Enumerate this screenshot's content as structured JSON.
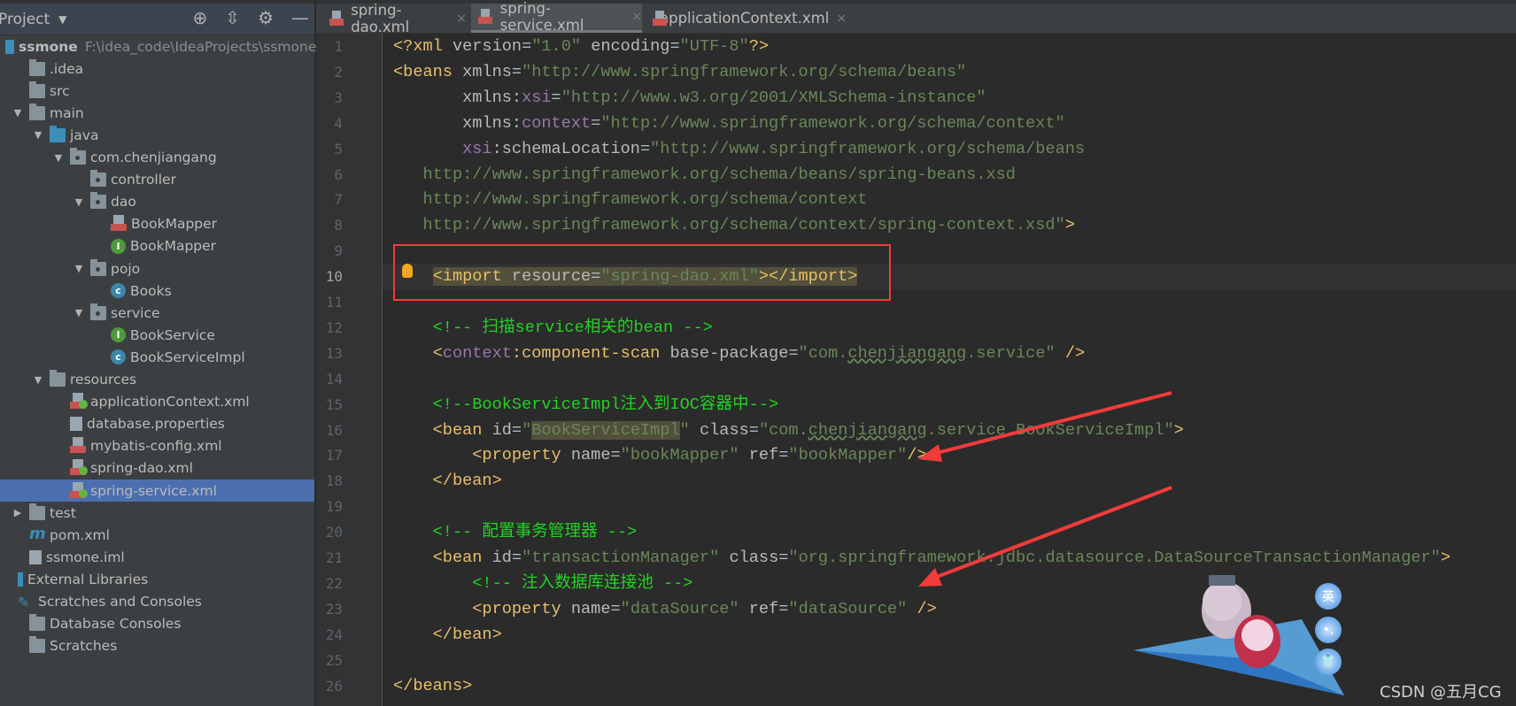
{
  "sidebar": {
    "title": "Project",
    "tools": [
      "crosshair-icon",
      "collapse-icon",
      "gear-icon",
      "minimize-icon"
    ],
    "tree": [
      {
        "level": 0,
        "icon": "module",
        "label": "ssmone",
        "path": "F:\\idea_code\\IdeaProjects\\ssmone",
        "bold": true
      },
      {
        "level": 1,
        "icon": "folder",
        "label": ".idea"
      },
      {
        "level": 1,
        "icon": "folder",
        "label": "src"
      },
      {
        "level": 1,
        "arrow": "down",
        "icon": "folder",
        "label": "main"
      },
      {
        "level": 2,
        "arrow": "down",
        "icon": "folder-blue",
        "label": "java"
      },
      {
        "level": 3,
        "arrow": "down",
        "icon": "package",
        "label": "com.chenjiangang"
      },
      {
        "level": 4,
        "icon": "package",
        "label": "controller"
      },
      {
        "level": 4,
        "arrow": "down",
        "icon": "package",
        "label": "dao"
      },
      {
        "level": 5,
        "icon": "xml",
        "label": "BookMapper"
      },
      {
        "level": 5,
        "icon": "interface",
        "label": "BookMapper"
      },
      {
        "level": 4,
        "arrow": "down",
        "icon": "package",
        "label": "pojo"
      },
      {
        "level": 5,
        "icon": "class",
        "label": "Books"
      },
      {
        "level": 4,
        "arrow": "down",
        "icon": "package",
        "label": "service"
      },
      {
        "level": 5,
        "icon": "interface",
        "label": "BookService"
      },
      {
        "level": 5,
        "icon": "class",
        "label": "BookServiceImpl"
      },
      {
        "level": 2,
        "arrow": "down",
        "icon": "folder-res",
        "label": "resources"
      },
      {
        "level": 3,
        "icon": "spring-xml",
        "label": "applicationContext.xml"
      },
      {
        "level": 3,
        "icon": "properties",
        "label": "database.properties"
      },
      {
        "level": 3,
        "icon": "xml",
        "label": "mybatis-config.xml"
      },
      {
        "level": 3,
        "icon": "spring-xml",
        "label": "spring-dao.xml"
      },
      {
        "level": 3,
        "icon": "spring-xml",
        "label": "spring-service.xml",
        "selected": true
      },
      {
        "level": 1,
        "arrow": "right",
        "icon": "folder",
        "label": "test"
      },
      {
        "level": 1,
        "icon": "maven",
        "label": "pom.xml"
      },
      {
        "level": 1,
        "icon": "iml",
        "label": "ssmone.iml"
      },
      {
        "level": 0,
        "icon": "libraries",
        "label": "External Libraries"
      },
      {
        "level": 0,
        "icon": "scratches",
        "label": "Scratches and Consoles"
      },
      {
        "level": 1,
        "icon": "folder",
        "label": "Database Consoles"
      },
      {
        "level": 1,
        "icon": "folder",
        "label": "Scratches"
      }
    ]
  },
  "tabs": [
    {
      "label": "spring-dao.xml",
      "close": "×"
    },
    {
      "label": "spring-service.xml",
      "close": "×",
      "active": true
    },
    {
      "label": "applicationContext.xml",
      "close": "×"
    }
  ],
  "editor": {
    "current_line": 10,
    "lines": [
      [
        [
          "tag",
          "<?xml "
        ],
        [
          "attr",
          "version"
        ],
        [
          "pl",
          "="
        ],
        [
          "val",
          "\"1.0\""
        ],
        [
          "pl",
          " "
        ],
        [
          "attr",
          "encoding"
        ],
        [
          "pl",
          "="
        ],
        [
          "val",
          "\"UTF-8\""
        ],
        [
          "tag",
          "?>"
        ]
      ],
      [
        [
          "tag",
          "<beans "
        ],
        [
          "attr",
          "xmlns"
        ],
        [
          "pl",
          "="
        ],
        [
          "val",
          "\"http://www.springframework.org/schema/beans\""
        ]
      ],
      [
        [
          "pl",
          "       "
        ],
        [
          "attr",
          "xmlns:"
        ],
        [
          "ns",
          "xsi"
        ],
        [
          "pl",
          "="
        ],
        [
          "val",
          "\"http://www.w3.org/2001/XMLSchema-instance\""
        ]
      ],
      [
        [
          "pl",
          "       "
        ],
        [
          "attr",
          "xmlns:"
        ],
        [
          "ns",
          "context"
        ],
        [
          "pl",
          "="
        ],
        [
          "val",
          "\"http://www.springframework.org/schema/context\""
        ]
      ],
      [
        [
          "pl",
          "       "
        ],
        [
          "ns",
          "xsi"
        ],
        [
          "attr",
          ":schemaLocation"
        ],
        [
          "pl",
          "="
        ],
        [
          "val",
          "\"http://www.springframework.org/schema/beans"
        ]
      ],
      [
        [
          "val",
          "   http://www.springframework.org/schema/beans/spring-beans.xsd"
        ]
      ],
      [
        [
          "val",
          "   http://www.springframework.org/schema/context"
        ]
      ],
      [
        [
          "val",
          "   http://www.springframework.org/schema/context/spring-context.xsd\""
        ],
        [
          "tag",
          ">"
        ]
      ],
      [],
      [
        [
          "pl",
          "    "
        ],
        [
          "tag hl",
          "<import "
        ],
        [
          "attr hl",
          "resource"
        ],
        [
          "pl hl",
          "="
        ],
        [
          "val hl",
          "\"spring-dao.xml\""
        ],
        [
          "tag hl",
          "></import>"
        ]
      ],
      [],
      [
        [
          "pl",
          "    "
        ],
        [
          "cm",
          "<!-- 扫描service相关的bean -->"
        ]
      ],
      [
        [
          "pl",
          "    "
        ],
        [
          "tag",
          "<"
        ],
        [
          "ns",
          "context"
        ],
        [
          "tag",
          ":component-scan "
        ],
        [
          "attr",
          "base-package"
        ],
        [
          "pl",
          "="
        ],
        [
          "val",
          "\"com."
        ],
        [
          "val wavy",
          "chenjiangang"
        ],
        [
          "val",
          ".service\""
        ],
        [
          "tag",
          " />"
        ]
      ],
      [],
      [
        [
          "pl",
          "    "
        ],
        [
          "cm",
          "<!--BookServiceImpl注入到IOC容器中-->"
        ]
      ],
      [
        [
          "pl",
          "    "
        ],
        [
          "tag",
          "<bean "
        ],
        [
          "attr",
          "id"
        ],
        [
          "pl",
          "="
        ],
        [
          "val",
          "\""
        ],
        [
          "val hl",
          "BookServiceImpl"
        ],
        [
          "val",
          "\""
        ],
        [
          "pl",
          " "
        ],
        [
          "attr",
          "class"
        ],
        [
          "pl",
          "="
        ],
        [
          "val",
          "\"com."
        ],
        [
          "val wavy",
          "chenjiangang"
        ],
        [
          "val",
          ".service.BookServiceImpl\""
        ],
        [
          "tag",
          ">"
        ]
      ],
      [
        [
          "pl",
          "        "
        ],
        [
          "tag",
          "<property "
        ],
        [
          "attr",
          "name"
        ],
        [
          "pl",
          "="
        ],
        [
          "val",
          "\"bookMapper\""
        ],
        [
          "pl",
          " "
        ],
        [
          "attr",
          "ref"
        ],
        [
          "pl",
          "="
        ],
        [
          "val",
          "\"bookMapper\""
        ],
        [
          "tag",
          "/>"
        ]
      ],
      [
        [
          "pl",
          "    "
        ],
        [
          "tag",
          "</bean>"
        ]
      ],
      [],
      [
        [
          "pl",
          "    "
        ],
        [
          "cm",
          "<!-- 配置事务管理器 -->"
        ]
      ],
      [
        [
          "pl",
          "    "
        ],
        [
          "tag",
          "<bean "
        ],
        [
          "attr",
          "id"
        ],
        [
          "pl",
          "="
        ],
        [
          "val",
          "\"transactionManager\""
        ],
        [
          "pl",
          " "
        ],
        [
          "attr",
          "class"
        ],
        [
          "pl",
          "="
        ],
        [
          "val",
          "\"org.springframework.jdbc.datasource.DataSourceTransactionManager\""
        ],
        [
          "tag",
          ">"
        ]
      ],
      [
        [
          "pl",
          "        "
        ],
        [
          "cm",
          "<!-- 注入数据库连接池 -->"
        ]
      ],
      [
        [
          "pl",
          "        "
        ],
        [
          "tag",
          "<property "
        ],
        [
          "attr",
          "name"
        ],
        [
          "pl",
          "="
        ],
        [
          "val",
          "\"dataSource\""
        ],
        [
          "pl",
          " "
        ],
        [
          "attr",
          "ref"
        ],
        [
          "pl",
          "="
        ],
        [
          "val",
          "\"dataSource\""
        ],
        [
          "tag",
          " />"
        ]
      ],
      [
        [
          "pl",
          "    "
        ],
        [
          "tag",
          "</bean>"
        ]
      ],
      [],
      [
        [
          "tag",
          "</beans>"
        ]
      ]
    ]
  },
  "overlay": {
    "highlight_color": "#f23b3b",
    "side_buttons": [
      "英",
      "•,",
      "👕"
    ],
    "watermark": "CSDN @五月CG"
  }
}
